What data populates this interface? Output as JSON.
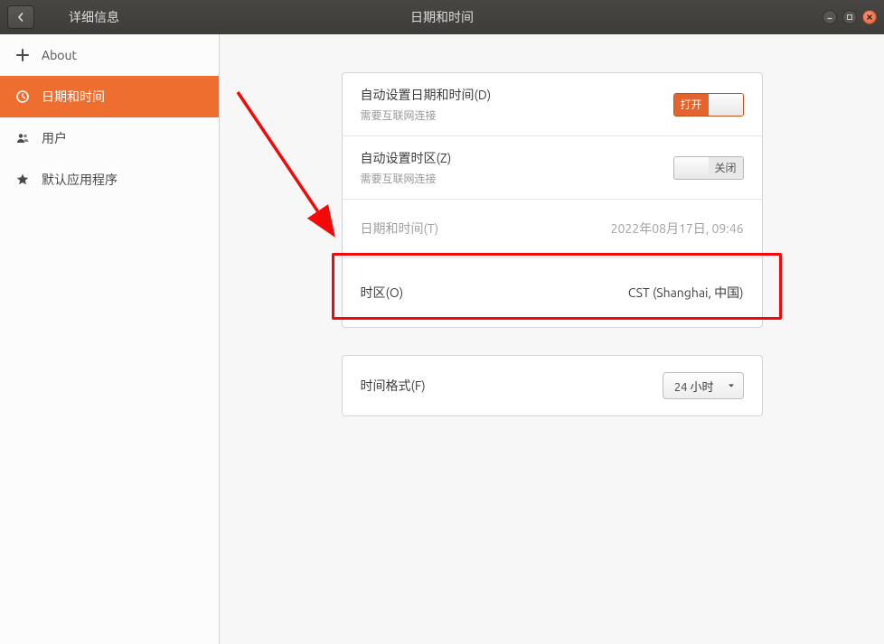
{
  "titlebar": {
    "left_title": "详细信息",
    "center_title": "日期和时间"
  },
  "sidebar": {
    "items": [
      {
        "label": "About"
      },
      {
        "label": "日期和时间"
      },
      {
        "label": "用户"
      },
      {
        "label": "默认应用程序"
      }
    ]
  },
  "rows": {
    "auto_datetime": {
      "label": "自动设置日期和时间(D)",
      "sub": "需要互联网连接",
      "toggle_text": "打开"
    },
    "auto_tz": {
      "label": "自动设置时区(Z)",
      "sub": "需要互联网连接",
      "toggle_text": "关闭"
    },
    "datetime": {
      "label": "日期和时间(T)",
      "value": "2022年08月17日, 09:46"
    },
    "tz": {
      "label": "时区(O)",
      "value": "CST (Shanghai, 中国)"
    },
    "format": {
      "label": "时间格式(F)",
      "value": "24 小时"
    }
  }
}
